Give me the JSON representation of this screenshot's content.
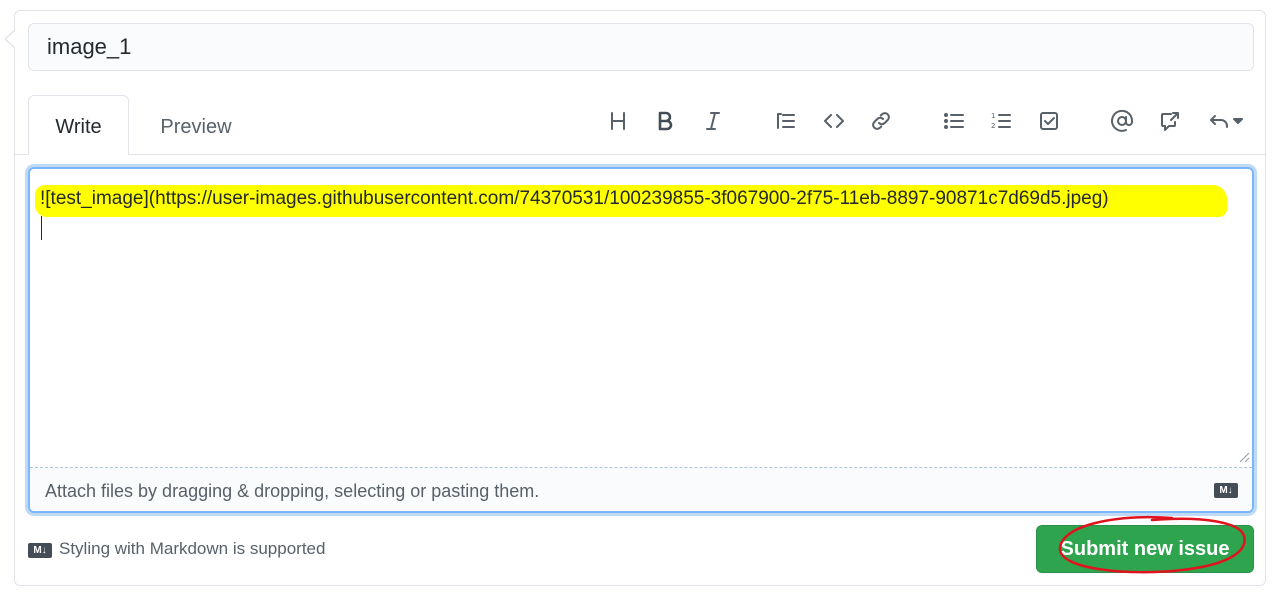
{
  "title_input": {
    "value": "image_1"
  },
  "tabs": [
    {
      "label": "Write"
    },
    {
      "label": "Preview"
    }
  ],
  "toolbar": [
    {
      "name": "heading-icon"
    },
    {
      "name": "bold-icon"
    },
    {
      "name": "italic-icon"
    },
    {
      "name": "quote-icon"
    },
    {
      "name": "code-icon"
    },
    {
      "name": "link-icon"
    },
    {
      "name": "bulleted-list-icon"
    },
    {
      "name": "numbered-list-icon"
    },
    {
      "name": "task-list-icon"
    },
    {
      "name": "mention-icon"
    },
    {
      "name": "cross-reference-icon"
    },
    {
      "name": "saved-replies-icon"
    }
  ],
  "editor": {
    "text": "![test_image](https://user-images.githubusercontent.com/74370531/100239855-3f067900-2f75-11eb-8897-90871c7d69d5.jpeg)",
    "attach_hint": "Attach files by dragging & dropping, selecting or pasting them."
  },
  "footer": {
    "markdown_badge": "M↓",
    "markdown_note": "Styling with Markdown is supported",
    "submit_label": "Submit new issue"
  },
  "colors": {
    "submit_green": "#2ea44f",
    "highlight": "#ffff00",
    "annotation_ring": "#e0141e",
    "focus_blue": "#79b8ff"
  }
}
